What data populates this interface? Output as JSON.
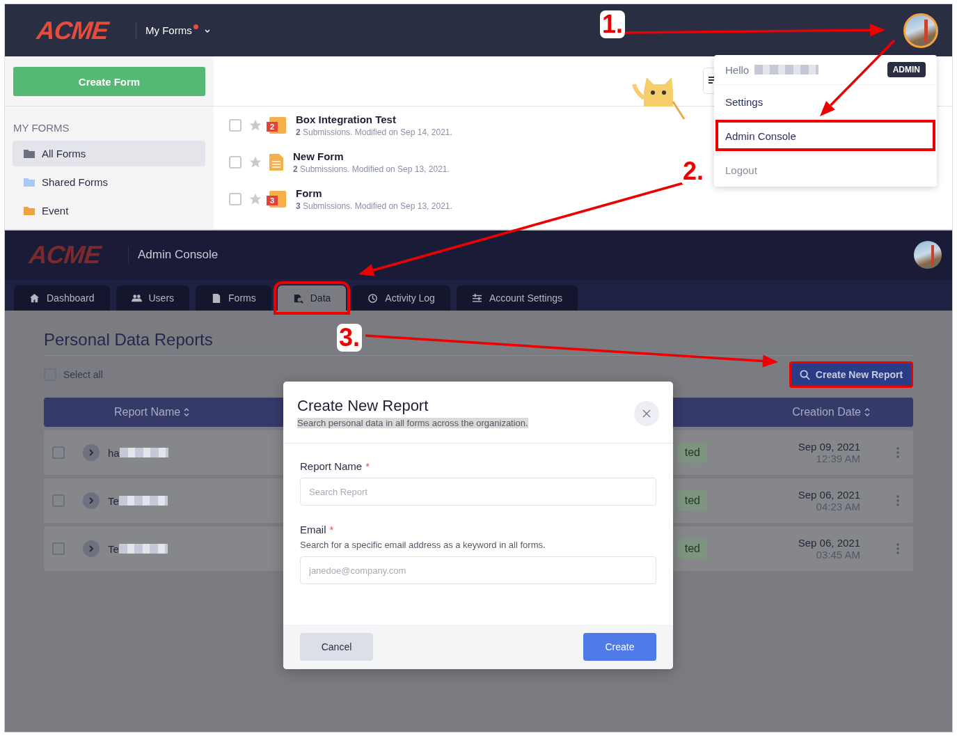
{
  "top_screen": {
    "logo": "ACME",
    "nav_menu": {
      "label": "My Forms",
      "notification": true
    },
    "create_button": "Create Form",
    "sidebar": {
      "heading": "MY FORMS",
      "items": [
        {
          "label": "All Forms",
          "selected": true,
          "color": "#6e6f80"
        },
        {
          "label": "Shared Forms",
          "selected": false,
          "color": "#a9c8f7"
        },
        {
          "label": "Event",
          "selected": false,
          "color": "#f2a23a"
        }
      ]
    },
    "forms": [
      {
        "title": "Box Integration Test",
        "meta": "**2** Submissions. Modified on Sep 14, 2021.",
        "badge": "2",
        "checked": false,
        "starred": false
      },
      {
        "title": "New Form",
        "meta": "**2** Submissions. Modified on Sep 13, 2021.",
        "checked": false,
        "starred": false
      },
      {
        "title": "Form",
        "meta": "**3** Submissions. Modified on Sep 13, 2021.",
        "badge": "3",
        "checked": false,
        "starred": false
      }
    ],
    "user_menu": {
      "greeting": "Hello",
      "role": "ADMIN",
      "items": [
        {
          "label": "Settings",
          "kind": "link",
          "annotated": false
        },
        {
          "label": "Admin Console",
          "kind": "link",
          "annotated": true
        },
        {
          "label": "Logout",
          "kind": "muted",
          "annotated": false
        }
      ]
    }
  },
  "bottom_screen": {
    "logo": "ACME",
    "title": "Admin Console",
    "tabs": [
      {
        "label": "Dashboard",
        "selected": false,
        "annotated": false
      },
      {
        "label": "Users",
        "selected": false,
        "annotated": false
      },
      {
        "label": "Forms",
        "selected": false,
        "annotated": false
      },
      {
        "label": "Data",
        "selected": true,
        "annotated": true
      },
      {
        "label": "Activity Log",
        "selected": false,
        "annotated": false
      },
      {
        "label": "Account Settings",
        "selected": false,
        "annotated": false
      }
    ],
    "page_title": "Personal Data Reports",
    "select_all": {
      "label": "Select all",
      "checked": false
    },
    "create_button": {
      "label": "Create New Report",
      "annotated": true
    },
    "table": {
      "columns": [
        "Report Name",
        "Creation Date"
      ],
      "rows": [
        {
          "name": "ha",
          "status": "ted",
          "date": "Sep 09, 2021",
          "time": "12:39 AM",
          "checked": false
        },
        {
          "name": "Te",
          "status": "ted",
          "date": "Sep 06, 2021",
          "time": "04:23 AM",
          "checked": false
        },
        {
          "name": "Te",
          "status": "ted",
          "date": "Sep 06, 2021",
          "time": "03:45 AM",
          "checked": false
        }
      ]
    },
    "modal": {
      "title": "Create New Report",
      "subtitle": "Search personal data in all forms across the organization.",
      "fields": [
        {
          "label": "Report Name",
          "required_mark": "*",
          "placeholder": "Search Report"
        },
        {
          "label": "Email",
          "required_mark": "*",
          "hint": "Search for a specific email address as a keyword in all forms.",
          "placeholder": "janedoe@company.com"
        }
      ],
      "buttons": [
        {
          "label": "Cancel",
          "kind": "secondary"
        },
        {
          "label": "Create",
          "kind": "primary"
        }
      ]
    }
  },
  "annotations": {
    "steps": [
      "1.",
      "2.",
      "3."
    ]
  }
}
